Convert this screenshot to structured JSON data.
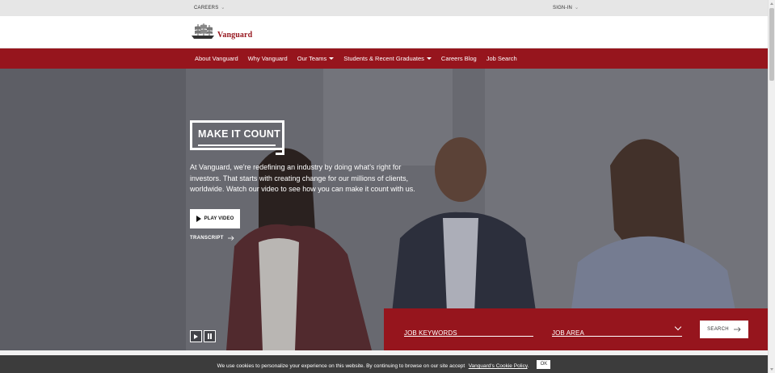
{
  "utility": {
    "careers_label": "CAREERS",
    "signin_label": "SIGN-IN"
  },
  "brand": {
    "logo_text": "Vanguard",
    "accent_color": "#96151d"
  },
  "nav": {
    "items": [
      {
        "label": "About Vanguard",
        "dropdown": false
      },
      {
        "label": "Why Vanguard",
        "dropdown": false
      },
      {
        "label": "Our Teams",
        "dropdown": true
      },
      {
        "label": "Students & Recent Graduates",
        "dropdown": true
      },
      {
        "label": "Careers Blog",
        "dropdown": false
      },
      {
        "label": "Job Search",
        "dropdown": false
      }
    ]
  },
  "hero": {
    "headline": "MAKE IT COUNT",
    "body": "At Vanguard, we're redefining an industry by doing what's right for investors. That starts with creating change for our millions of clients, worldwide. Watch our video to see how you can make it count with us.",
    "play_label": "PLAY VIDEO",
    "transcript_label": "TRANSCRIPT"
  },
  "search": {
    "keywords_label": "JOB KEYWORDS",
    "area_label": "JOB AREA",
    "search_label": "SEARCH"
  },
  "cookie": {
    "text": "We use cookies to personalize your experience on this website. By continuing to browse on our site accept",
    "link_label": "Vanguard's Cookie Policy",
    "period": ".",
    "ok_label": "OK"
  }
}
